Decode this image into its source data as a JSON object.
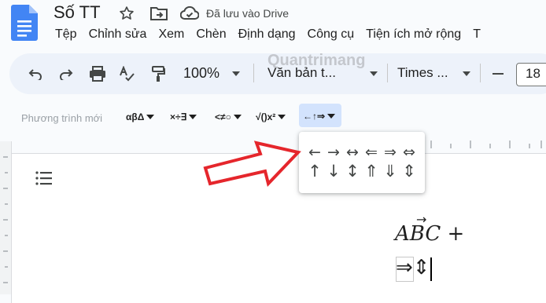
{
  "header": {
    "doc_title": "Số TT",
    "saved_status": "Đã lưu vào Drive"
  },
  "menu": {
    "items": [
      "Tệp",
      "Chỉnh sửa",
      "Xem",
      "Chèn",
      "Định dạng",
      "Công cụ",
      "Tiện ích mở rộng",
      "T"
    ]
  },
  "toolbar": {
    "zoom": "100%",
    "style": "Văn bản t...",
    "font": "Times ...",
    "font_size": "18"
  },
  "equation_toolbar": {
    "new_equation": "Phương trình mới",
    "groups": [
      "αβΔ",
      "×÷∃",
      "<≠○",
      "√()x²",
      "←↑⇒"
    ]
  },
  "arrow_menu": {
    "row1": [
      "←",
      "→",
      "↔",
      "⇐",
      "⇒",
      "⇔"
    ],
    "row2": [
      "↑",
      "↓",
      "↕",
      "⇑",
      "⇓",
      "⇕"
    ]
  },
  "document": {
    "eq_line1": "ABC  +",
    "eq_vector": "→",
    "eq_line2_a": "⇒",
    "eq_line2_b": "⇕"
  },
  "watermark": "Quantrimang",
  "colors": {
    "toolbar_bg": "#edf2fa",
    "selected_btn": "#d3e3fd",
    "annotation_arrow": "#e5262c",
    "docs_blue": "#4285f4"
  }
}
